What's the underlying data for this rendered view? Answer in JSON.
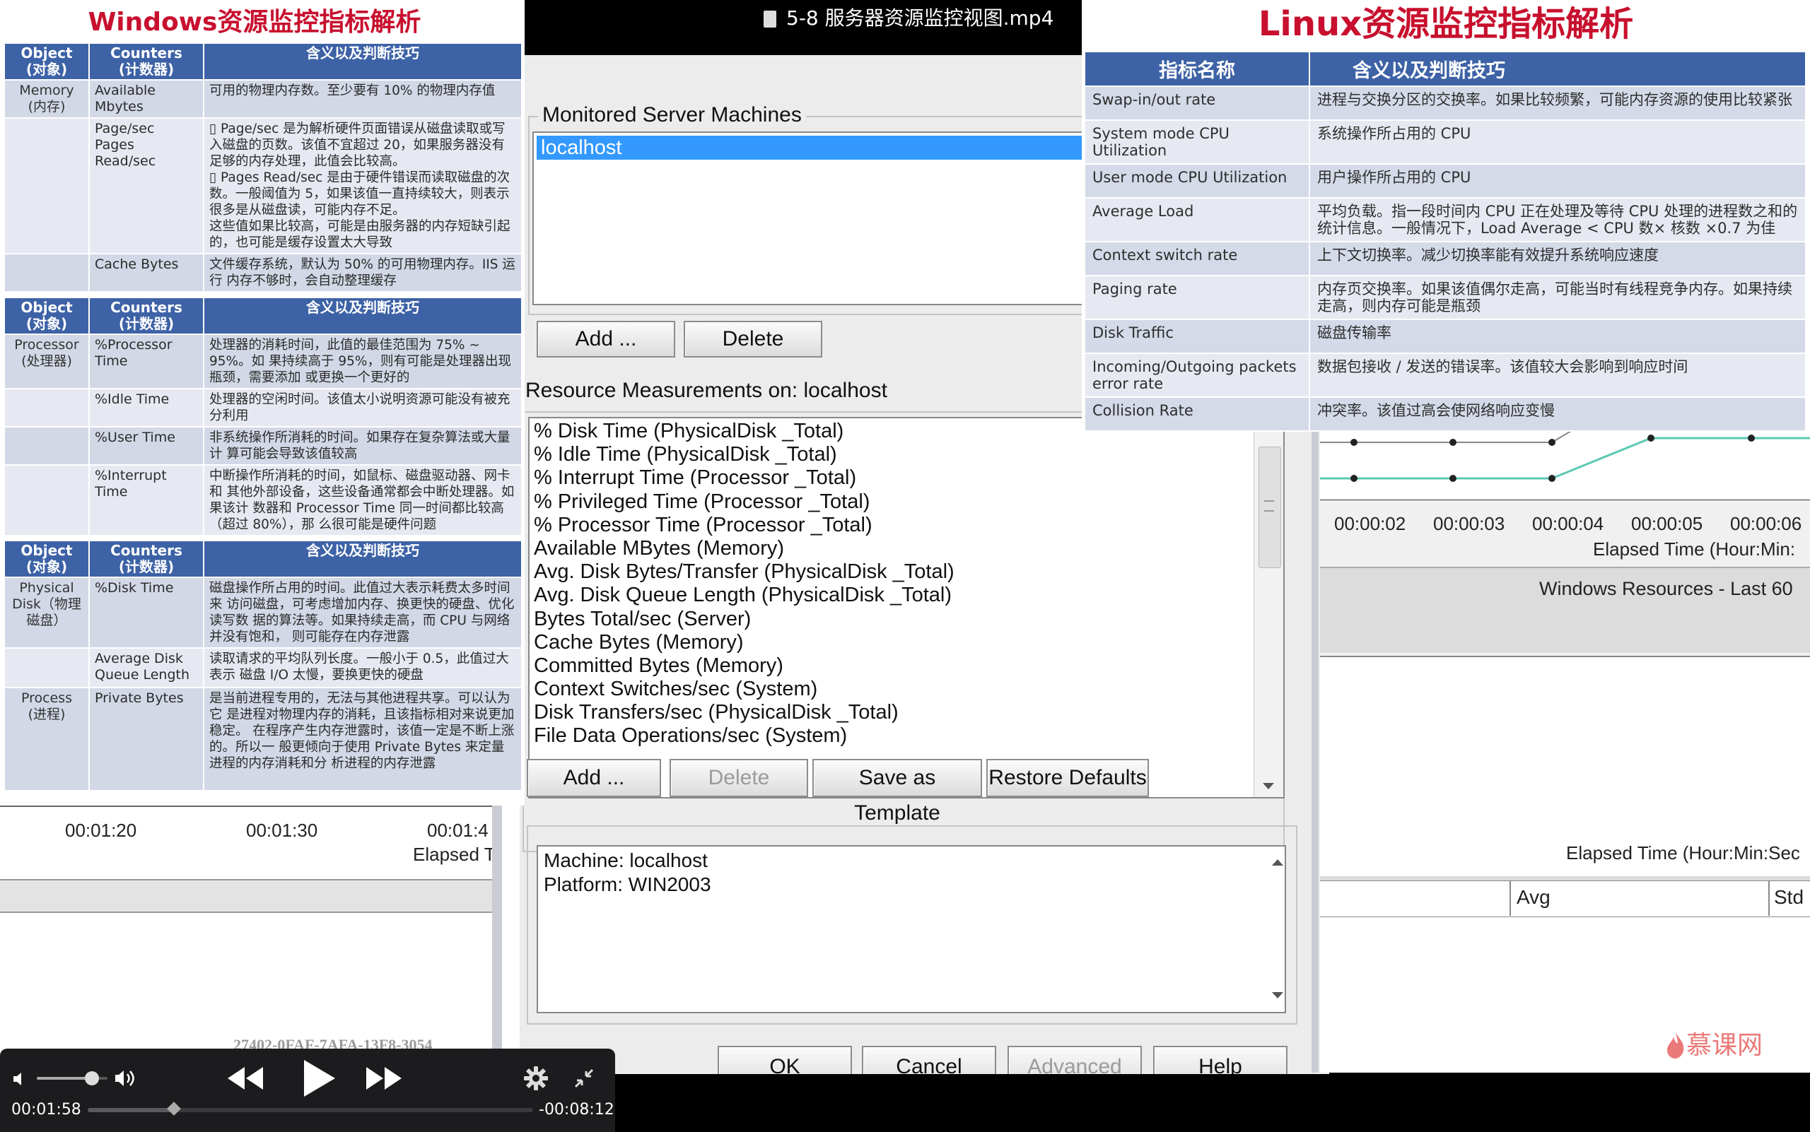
{
  "video": {
    "title": "5-8 服务器资源监控视图.mp4"
  },
  "windows_panel": {
    "title": "Windows资源监控指标解析",
    "header": {
      "object": "Object\n(对象)",
      "counters": "Counters\n(计数器)",
      "meaning": "含义以及判断技巧"
    },
    "table1": [
      {
        "object": "Memory\n(内存)",
        "counter": "Available\nMbytes",
        "desc": "可用的物理内存数。至少要有 10% 的物理内存值"
      },
      {
        "object": "",
        "counter": "Page/sec\nPages Read/sec",
        "desc": "▯ Page/sec 是为解析硬件页面错误从磁盘读取或写入磁盘的页数。该值不宜超过 20，如果服务器没有足够的内存处理，此值会比较高。\n▯ Pages Read/sec 是由于硬件错误而读取磁盘的次数。一般阈值为 5，如果该值一直持续较大，则表示很多是从磁盘读，可能内存不足。\n这些值如果比较高，可能是由服务器的内存短缺引起的，也可能是缓存设置太大导致"
      },
      {
        "object": "",
        "counter": "Cache Bytes",
        "desc": "文件缓存系统，默认为 50% 的可用物理内存。IIS 运行 内存不够时，会自动整理缓存"
      }
    ],
    "table2": [
      {
        "object": "Processor\n(处理器)",
        "counter": "%Processor\nTime",
        "desc": "处理器的消耗时间，此值的最佳范围为 75% ~ 95%。如 果持续高于 95%，则有可能是处理器出现瓶颈，需要添加 或更换一个更好的"
      },
      {
        "object": "",
        "counter": "%Idle Time",
        "desc": "处理器的空闲时间。该值太小说明资源可能没有被充分利用"
      },
      {
        "object": "",
        "counter": "%User Time",
        "desc": "非系统操作所消耗的时间。如果存在复杂算法或大量计 算可能会导致该值较高"
      },
      {
        "object": "",
        "counter": "%Interrupt\nTime",
        "desc": "中断操作所消耗的时间，如鼠标、磁盘驱动器、网卡和 其他外部设备，这些设备通常都会中断处理器。如果该计 数器和 Processor Time 同一时间都比较高（超过 80%），那 么很可能是硬件问题"
      }
    ],
    "table3": [
      {
        "object": "Physical\nDisk（物理\n磁盘）",
        "counter": "%Disk Time",
        "desc": "磁盘操作所占用的时间。此值过大表示耗费太多时间来 访问磁盘，可考虑增加内存、换更快的硬盘、优化读写数 据的算法等。如果持续走高，而 CPU 与网络并没有饱和， 则可能存在内存泄露"
      },
      {
        "object": "",
        "counter": "Average Disk\nQueue Length",
        "desc": "读取请求的平均队列长度。一般小于 0.5，此值过大表示 磁盘 I/O 太慢，要换更快的硬盘"
      },
      {
        "object": "Process\n(进程)",
        "counter": "Private Bytes",
        "desc": "是当前进程专用的，无法与其他进程共享。可以认为它 是进程对物理内存的消耗，且该指标相对来说更加稳定。 在程序产生内存泄露时，该值一定是不断上涨的。所以一 般更倾向于使用 Private Bytes 来定量进程的内存消耗和分 析进程的内存泄露"
      }
    ]
  },
  "linux_panel": {
    "title": "Linux资源监控指标解析",
    "header": {
      "name": "指标名称",
      "meaning": "含义以及判断技巧"
    },
    "rows": [
      {
        "name": "Swap-in/out rate",
        "desc": "进程与交换分区的交换率。如果比较频繁，可能内存资源的使用比较紧张"
      },
      {
        "name": "System mode CPU Utilization",
        "desc": "系统操作所占用的 CPU"
      },
      {
        "name": "User mode CPU Utilization",
        "desc": "用户操作所占用的 CPU"
      },
      {
        "name": "Average Load",
        "desc": "平均负载。指一段时间内 CPU 正在处理及等待 CPU 处理的进程数之和的统计信息。一般情况下，Load Average < CPU 数× 核数 ×0.7 为佳"
      },
      {
        "name": "Context switch rate",
        "desc": "上下文切换率。减少切换率能有效提升系统响应速度"
      },
      {
        "name": "Paging rate",
        "desc": "内存页交换率。如果该值偶尔走高，可能当时有线程竞争内存。如果持续走高，则内存可能是瓶颈"
      },
      {
        "name": "Disk Traffic",
        "desc": "磁盘传输率"
      },
      {
        "name": "Incoming/Outgoing packets error rate",
        "desc": "数据包接收 / 发送的错误率。该值较大会影响到响应时间"
      },
      {
        "name": "Collision Rate",
        "desc": "冲突率。该值过高会使网络响应变慢"
      }
    ]
  },
  "dialog": {
    "monitored_label": "Monitored Server Machines",
    "machines": [
      "localhost"
    ],
    "add_label": "Add ...",
    "delete_label": "Delete",
    "measurements_label": "Resource Measurements on: localhost",
    "measurements": [
      "% Disk Time (PhysicalDisk _Total)",
      "% Idle Time (PhysicalDisk _Total)",
      "% Interrupt Time (Processor _Total)",
      "% Privileged Time (Processor _Total)",
      "% Processor Time (Processor _Total)",
      "Available MBytes (Memory)",
      "Avg. Disk Bytes/Transfer (PhysicalDisk _Total)",
      "Avg. Disk Queue Length (PhysicalDisk _Total)",
      "Bytes Total/sec (Server)",
      "Cache Bytes (Memory)",
      "Committed Bytes (Memory)",
      "Context Switches/sec (System)",
      "Disk Transfers/sec (PhysicalDisk _Total)",
      "File Data Operations/sec (System)"
    ],
    "add2_label": "Add ...",
    "delete2_label": "Delete",
    "save_template_label": "Save as Template",
    "restore_defaults_label": "Restore Defaults",
    "info_machine": "Machine: localhost",
    "info_platform": "Platform: WIN2003",
    "ok_label": "OK",
    "cancel_label": "Cancel",
    "advanced_label": "Advanced",
    "help_label": "Help"
  },
  "right_graph": {
    "ticks": [
      "00:00:02",
      "00:00:03",
      "00:00:04",
      "00:00:05",
      "00:00:06"
    ],
    "axis_label": "Elapsed Time (Hour:Min:",
    "panel_title": "Windows Resources - Last 60",
    "axis_label2": "Elapsed Time (Hour:Min:Sec",
    "col_avg": "Avg",
    "col_std": "Std",
    "line_color": "#5bc8b4"
  },
  "left_graph": {
    "ticks": [
      "00:01:20",
      "00:01:30",
      "00:01:4"
    ],
    "axis_label": "Elapsed T",
    "watermark": "27402-0FAF-7AFA-13F8-3054"
  },
  "player": {
    "current_time": "00:01:58",
    "remaining_time": "-00:08:12",
    "progress": 0.194,
    "volume": 0.78
  },
  "logo_text": "慕课网",
  "colors": {
    "accent_red": "#c8102e",
    "table_header": "#3d62a6",
    "selection": "#3399ff"
  }
}
